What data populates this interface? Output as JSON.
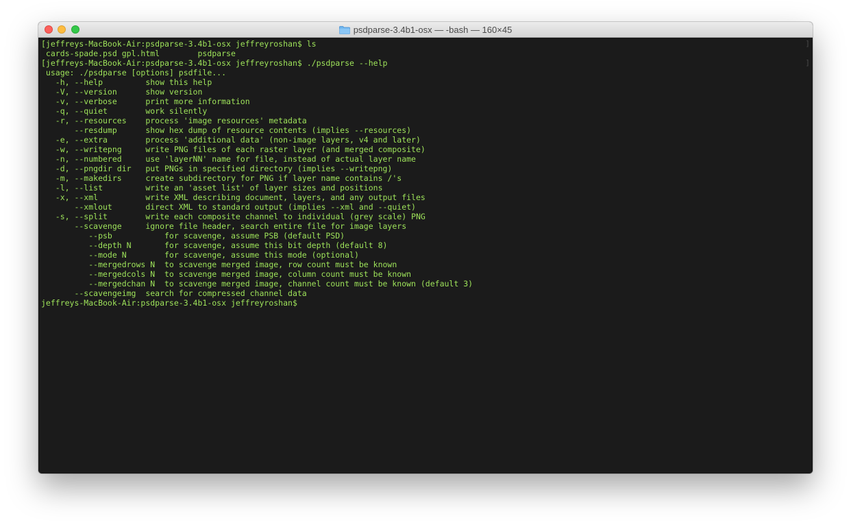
{
  "window": {
    "title": "psdparse-3.4b1-osx — -bash — 160×45",
    "folder_icon": "folder-icon"
  },
  "colors": {
    "terminal_bg": "#1b1b1b",
    "terminal_text": "#9ee35a"
  },
  "terminal": {
    "lines": [
      "[jeffreys-MacBook-Air:psdparse-3.4b1-osx jeffreyroshan$ ls",
      " cards-spade.psd gpl.html        psdparse",
      "[jeffreys-MacBook-Air:psdparse-3.4b1-osx jeffreyroshan$ ./psdparse --help",
      " usage: ./psdparse [options] psdfile...",
      "   -h, --help         show this help",
      "   -V, --version      show version",
      "   -v, --verbose      print more information",
      "   -q, --quiet        work silently",
      "   -r, --resources    process 'image resources' metadata",
      "       --resdump      show hex dump of resource contents (implies --resources)",
      "   -e, --extra        process 'additional data' (non-image layers, v4 and later)",
      "   -w, --writepng     write PNG files of each raster layer (and merged composite)",
      "   -n, --numbered     use 'layerNN' name for file, instead of actual layer name",
      "   -d, --pngdir dir   put PNGs in specified directory (implies --writepng)",
      "   -m, --makedirs     create subdirectory for PNG if layer name contains /'s",
      "   -l, --list         write an 'asset list' of layer sizes and positions",
      "   -x, --xml          write XML describing document, layers, and any output files",
      "       --xmlout       direct XML to standard output (implies --xml and --quiet)",
      "   -s, --split        write each composite channel to individual (grey scale) PNG",
      "       --scavenge     ignore file header, search entire file for image layers",
      "          --psb           for scavenge, assume PSB (default PSD)",
      "          --depth N       for scavenge, assume this bit depth (default 8)",
      "          --mode N        for scavenge, assume this mode (optional)",
      "          --mergedrows N  to scavenge merged image, row count must be known",
      "          --mergedcols N  to scavenge merged image, column count must be known",
      "          --mergedchan N  to scavenge merged image, channel count must be known (default 3)",
      "       --scavengeimg  search for compressed channel data",
      "jeffreys-MacBook-Air:psdparse-3.4b1-osx jeffreyroshan$ "
    ],
    "right_markers": [
      "]",
      "]"
    ]
  }
}
